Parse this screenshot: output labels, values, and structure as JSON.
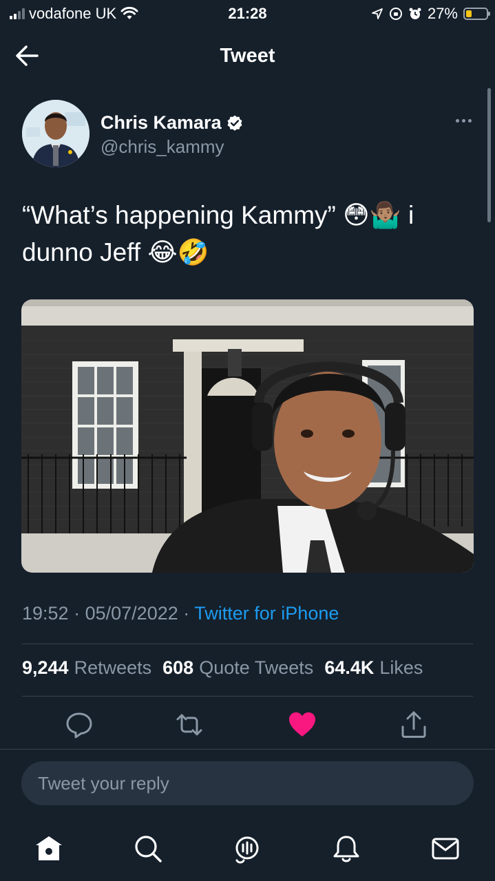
{
  "status_bar": {
    "carrier": "vodafone UK",
    "time": "21:28",
    "battery": "27%",
    "battery_level": 0.27
  },
  "header": {
    "title": "Tweet",
    "back_icon": "arrow-left-icon"
  },
  "tweet": {
    "author": {
      "display_name": "Chris Kamara",
      "handle": "@chris_kammy",
      "verified": true
    },
    "text_line1": "“What’s happening Kammy” 😳🤷🏽‍♂️ i",
    "text_line2": "dunno Jeff 😂🤣",
    "timestamp_time": "19:52",
    "timestamp_date": "05/07/2022",
    "separator": "·",
    "source": "Twitter for iPhone",
    "stats": {
      "retweets_count": "9,244",
      "retweets_label": "Retweets",
      "quotes_count": "608",
      "quotes_label": "Quote Tweets",
      "likes_count": "64.4K",
      "likes_label": "Likes"
    }
  },
  "actions": [
    "reply-icon",
    "retweet-icon",
    "heart-icon",
    "share-icon"
  ],
  "reply": {
    "placeholder": "Tweet your reply"
  },
  "nav": [
    "home-icon",
    "search-icon",
    "spaces-icon",
    "notifications-icon",
    "messages-icon"
  ],
  "colors": {
    "background": "#15202b",
    "accent": "#1d9bf0",
    "like": "#f91880",
    "muted": "#8b98a5",
    "divider": "#38444d"
  }
}
